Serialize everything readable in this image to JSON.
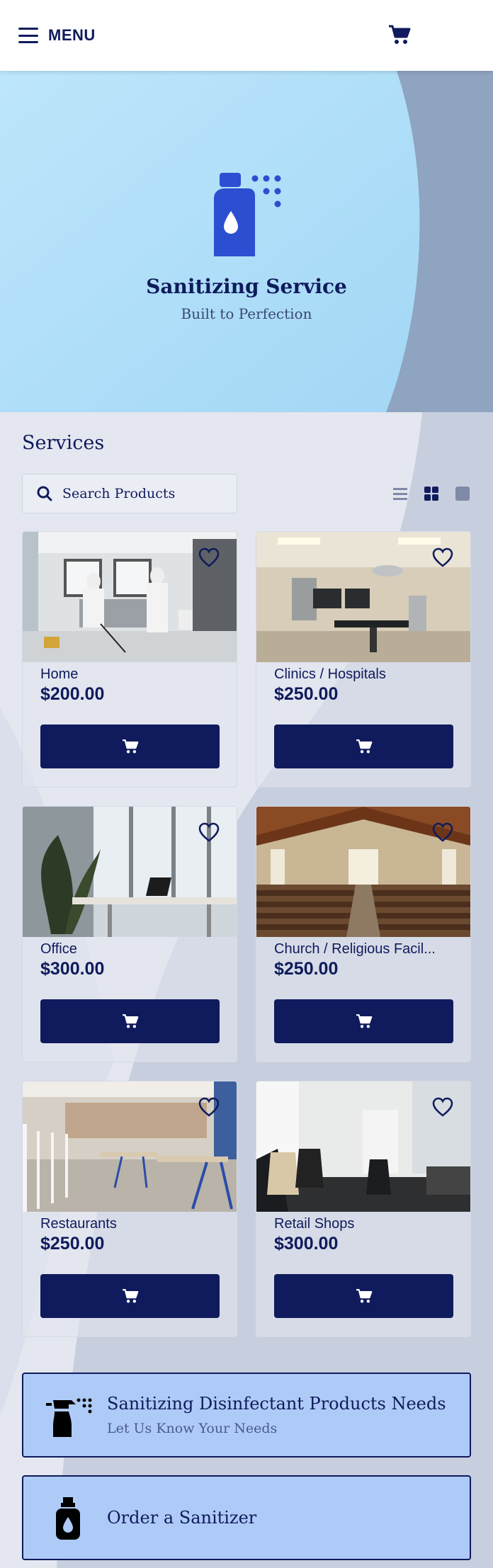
{
  "header": {
    "menu_label": "MENU",
    "menu_icon": "hamburger-icon",
    "cart_icon": "shopping-cart-icon"
  },
  "hero": {
    "logo_icon": "spray-bottle-icon",
    "title": "Sanitizing Service",
    "subtitle": "Built to Perfection"
  },
  "services": {
    "title": "Services",
    "search": {
      "placeholder": "Search Products",
      "value": ""
    },
    "view_modes": [
      "list-view-icon",
      "grid-view-icon",
      "single-view-icon"
    ],
    "selected_view": "grid"
  },
  "products": [
    {
      "name": "Home",
      "price": "$200.00",
      "image": "home-cleaning-photo"
    },
    {
      "name": "Clinics / Hospitals",
      "price": "$250.00",
      "image": "hospital-room-photo"
    },
    {
      "name": "Office",
      "price": "$300.00",
      "image": "office-photo"
    },
    {
      "name": "Church / Religious Facil...",
      "price": "$250.00",
      "image": "church-photo"
    },
    {
      "name": "Restaurants",
      "price": "$250.00",
      "image": "restaurant-photo"
    },
    {
      "name": "Retail Shops",
      "price": "$300.00",
      "image": "retail-shop-photo"
    }
  ],
  "ctas": [
    {
      "title": "Sanitizing Disinfectant Products Needs",
      "subtitle": "Let Us Know Your Needs",
      "icon": "spray-trigger-icon"
    },
    {
      "title": "Order a Sanitizer",
      "subtitle": "",
      "icon": "sanitizer-bottle-icon"
    }
  ],
  "colors": {
    "primary": "#0f1b5c",
    "accent": "#2b4fd0",
    "hero_bg": "#a9dcf7",
    "cta_bg": "#aecbf7"
  }
}
